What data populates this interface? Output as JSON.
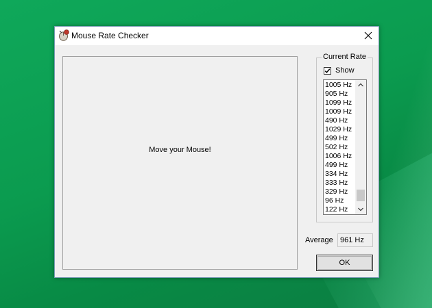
{
  "window": {
    "title": "Mouse Rate Checker"
  },
  "mouse_area": {
    "prompt": "Move your Mouse!"
  },
  "current_rate": {
    "group_label": "Current Rate",
    "show_label": "Show",
    "show_checked": true,
    "rates": [
      "1005 Hz",
      "905 Hz",
      "1099 Hz",
      "1009 Hz",
      "490 Hz",
      "1029 Hz",
      "499 Hz",
      "502 Hz",
      "1006 Hz",
      "499 Hz",
      "334 Hz",
      "333 Hz",
      "329 Hz",
      "96 Hz",
      "122 Hz"
    ]
  },
  "average": {
    "label": "Average",
    "value": "961 Hz"
  },
  "buttons": {
    "ok_label": "OK"
  },
  "icons": {
    "app": "mouse-app-icon",
    "close": "close-icon",
    "check": "checkmark-icon",
    "scroll_up": "chevron-up-icon",
    "scroll_down": "chevron-down-icon"
  },
  "colors": {
    "desktop": "#0b9b4f",
    "window_bg": "#f0f0f0",
    "titlebar_bg": "#ffffff",
    "scroll_thumb": "#c8c8c8"
  }
}
